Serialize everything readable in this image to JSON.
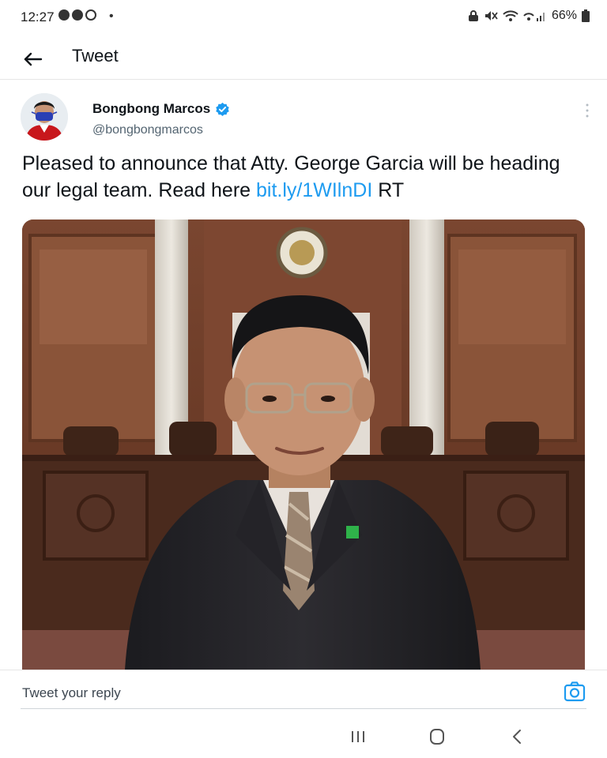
{
  "status_bar": {
    "time": "12:27",
    "separator": "•",
    "battery_text": "66%",
    "icons_left": [
      "shield-icon",
      "vpn-icon",
      "whatsapp-icon"
    ],
    "icons_right": [
      "lock-icon",
      "mute-icon",
      "wifi-icon",
      "signal-icon",
      "battery-icon"
    ]
  },
  "header": {
    "title": "Tweet"
  },
  "tweet": {
    "author_name": "Bongbong Marcos",
    "author_handle": "@bongbongmarcos",
    "text_before_link": "Pleased to announce that Atty. George Garcia will be heading our legal team. Read here ",
    "link_text": "bit.ly/1WIlnDI",
    "text_after_link": " RT"
  },
  "reply": {
    "placeholder": "Tweet your reply"
  },
  "colors": {
    "accent": "#1d9bf0",
    "text_primary": "#0f1419",
    "text_secondary": "#536471",
    "divider": "#e6e6e6"
  }
}
